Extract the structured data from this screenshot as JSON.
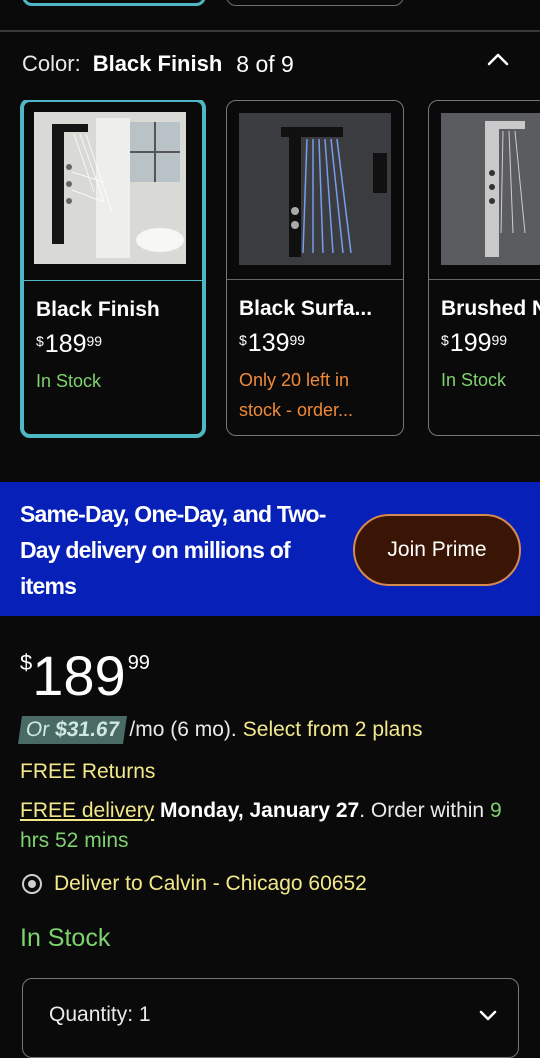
{
  "color_selector": {
    "label": "Color:",
    "value": "Black Finish",
    "count": "8 of 9"
  },
  "variants": [
    {
      "name": "Black Finish",
      "currency": "$",
      "price_whole": "189",
      "price_cents": "99",
      "stock": "In Stock",
      "selected": true
    },
    {
      "name": "Black Surfa...",
      "currency": "$",
      "price_whole": "139",
      "price_cents": "99",
      "stock": "Only 20 left in stock - order...",
      "selected": false
    },
    {
      "name": "Brushed N",
      "currency": "$",
      "price_whole": "199",
      "price_cents": "99",
      "stock": "In Stock",
      "selected": false
    }
  ],
  "prime_banner": {
    "text": "Same-Day, One-Day, and Two-Day delivery on millions of items",
    "button_label": "Join Prime"
  },
  "price": {
    "currency": "$",
    "whole": "189",
    "cents": "99"
  },
  "payment_plan": {
    "prefix": "Or",
    "amount": "$31.67",
    "suffix": "/mo (6 mo).",
    "link": "Select from 2 plans"
  },
  "free_returns": "FREE Returns",
  "delivery": {
    "link": "FREE delivery",
    "date": "Monday, January 27",
    "within_prefix": ". Order within",
    "within_time": "9 hrs 52 mins"
  },
  "deliver_to": "Deliver to Calvin - Chicago 60652",
  "stock_status": "In Stock",
  "quantity": {
    "label": "Quantity:",
    "value": "1"
  },
  "colors": {
    "selected_border": "#4fb8c6",
    "in_stock": "#7ed26f",
    "low_stock": "#f08a38",
    "link": "#f3e88a",
    "prime_banner_bg": "#0721b8",
    "prime_button_bg": "#3a1404"
  },
  "icons": {
    "collapse": "chevron-up-icon",
    "location": "location-pin-icon",
    "quantity_dropdown": "chevron-down-icon"
  }
}
